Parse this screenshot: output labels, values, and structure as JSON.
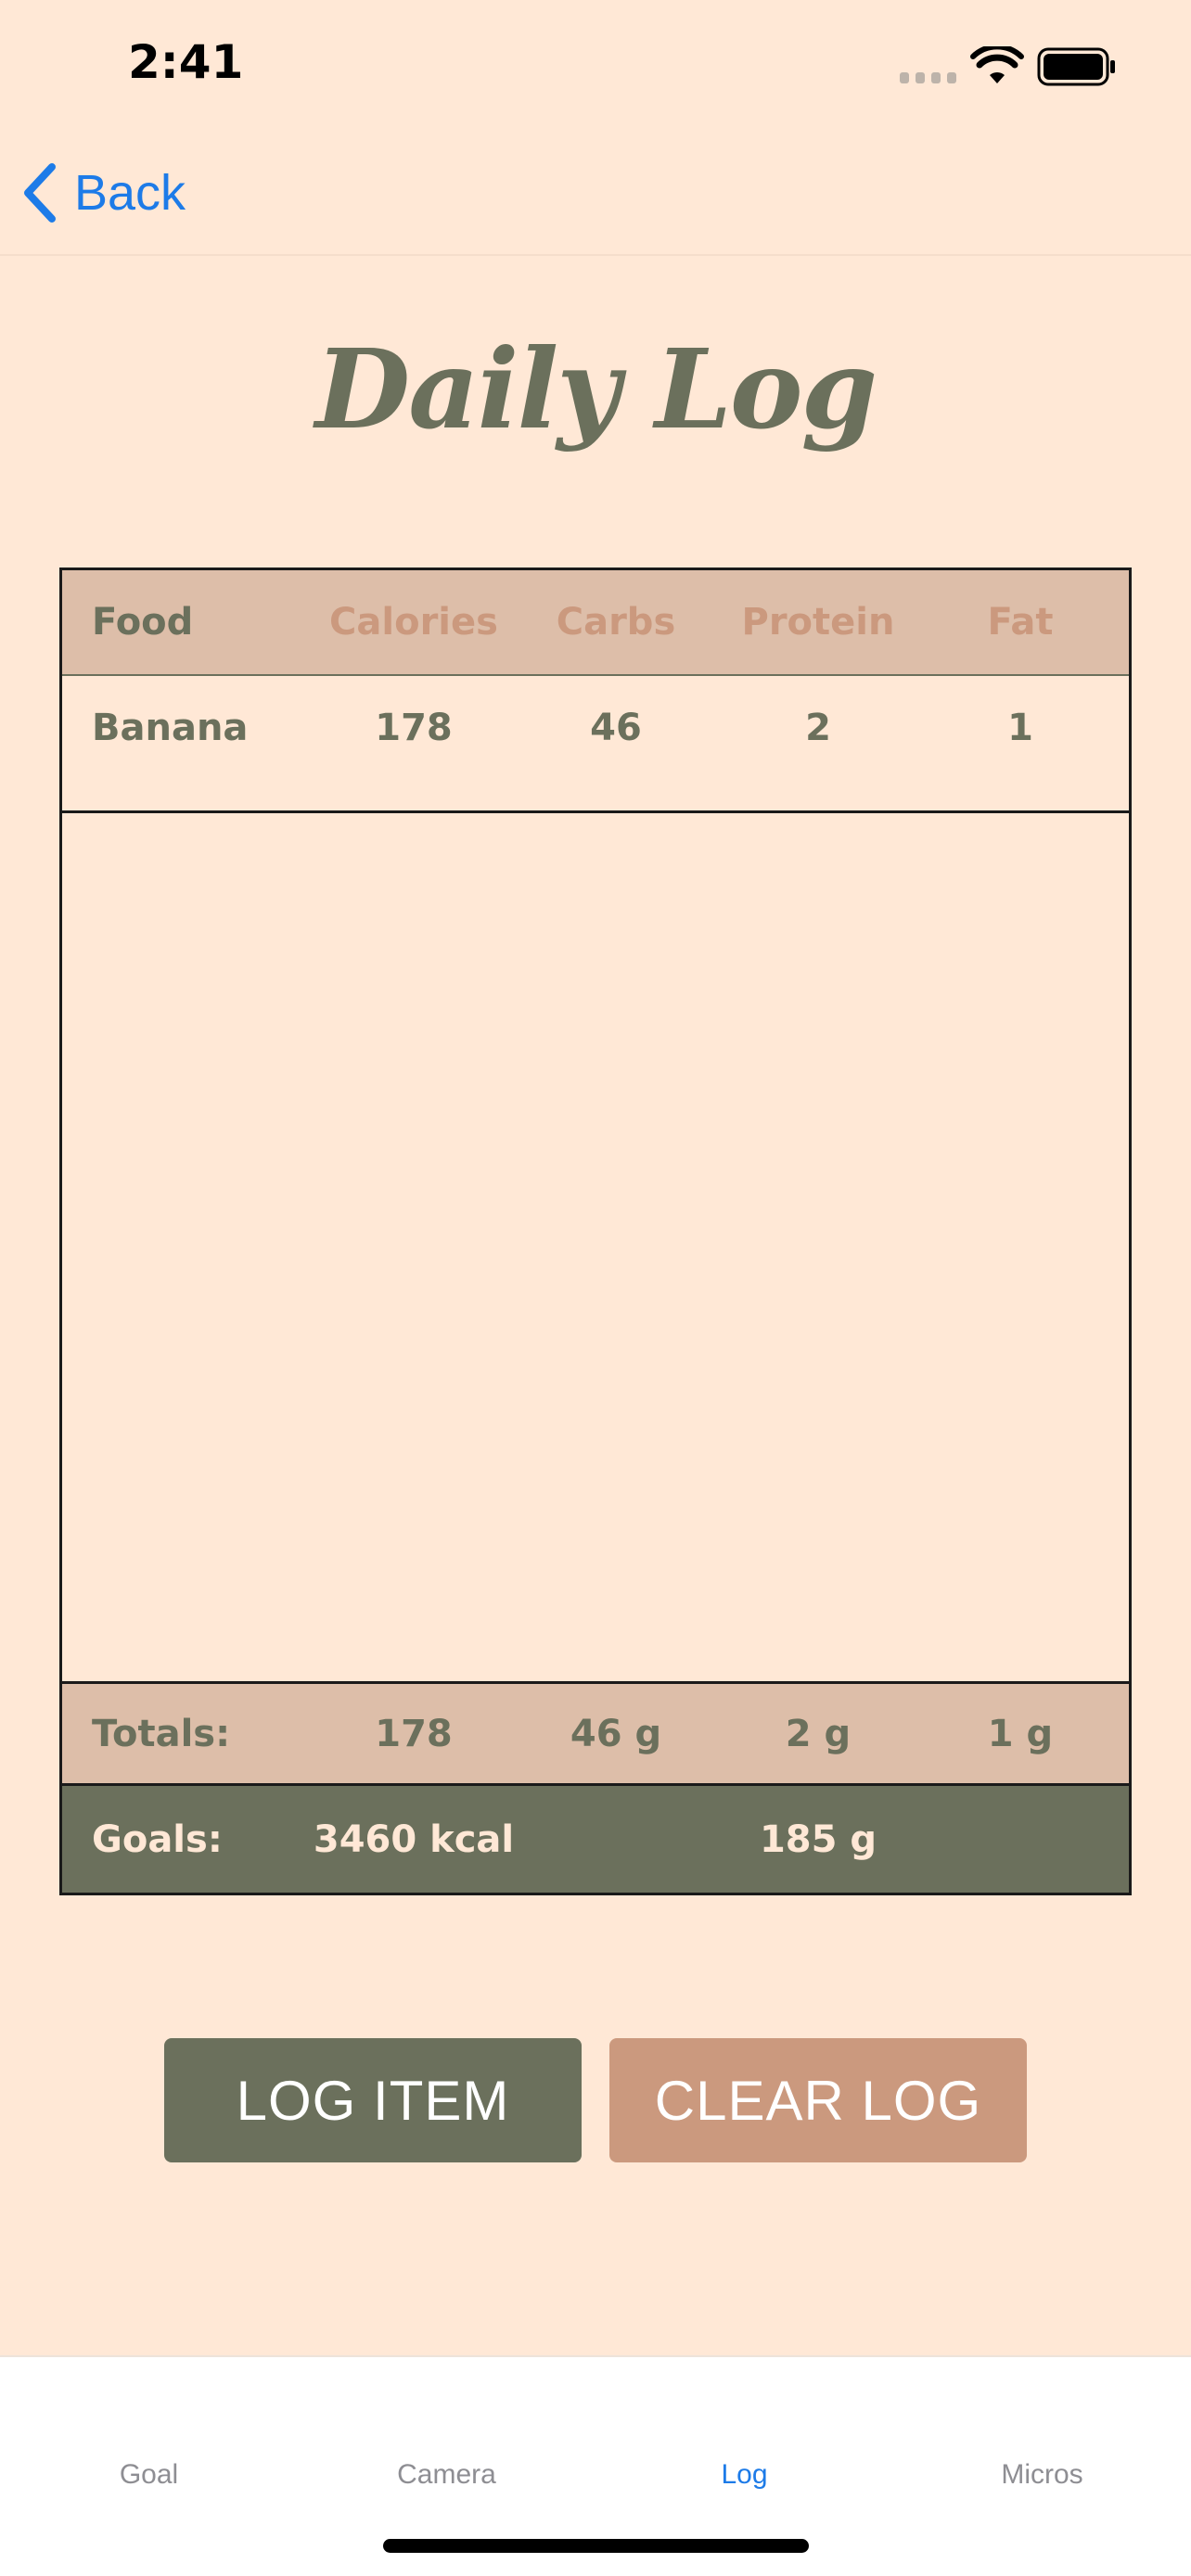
{
  "status_bar": {
    "time": "2:41"
  },
  "nav": {
    "back_label": "Back"
  },
  "page": {
    "title": "Daily Log"
  },
  "table": {
    "columns": [
      "Food",
      "Calories",
      "Carbs",
      "Protein",
      "Fat"
    ],
    "rows": [
      [
        "Banana",
        "178",
        "46",
        "2",
        "1"
      ]
    ],
    "totals": [
      "Totals:",
      "178",
      "46 g",
      "2 g",
      "1 g"
    ],
    "goals": {
      "label": "Goals:",
      "calories": "3460 kcal",
      "protein": "185 g"
    }
  },
  "actions": {
    "log_item_label": "LOG ITEM",
    "clear_log_label": "CLEAR LOG"
  },
  "tabs": [
    {
      "label": "Goal",
      "active": false
    },
    {
      "label": "Camera",
      "active": false
    },
    {
      "label": "Log",
      "active": true
    },
    {
      "label": "Micros",
      "active": false
    }
  ],
  "colors": {
    "background": "#FFE8D6",
    "olive": "#6B705C",
    "tan": "#DDBEA9",
    "clay": "#CB997E",
    "link_blue": "#1D7BE8"
  },
  "icons": {
    "back": "chevron-left-icon",
    "signal": "cellular-signal-icon",
    "wifi": "wifi-icon",
    "battery": "battery-icon"
  }
}
